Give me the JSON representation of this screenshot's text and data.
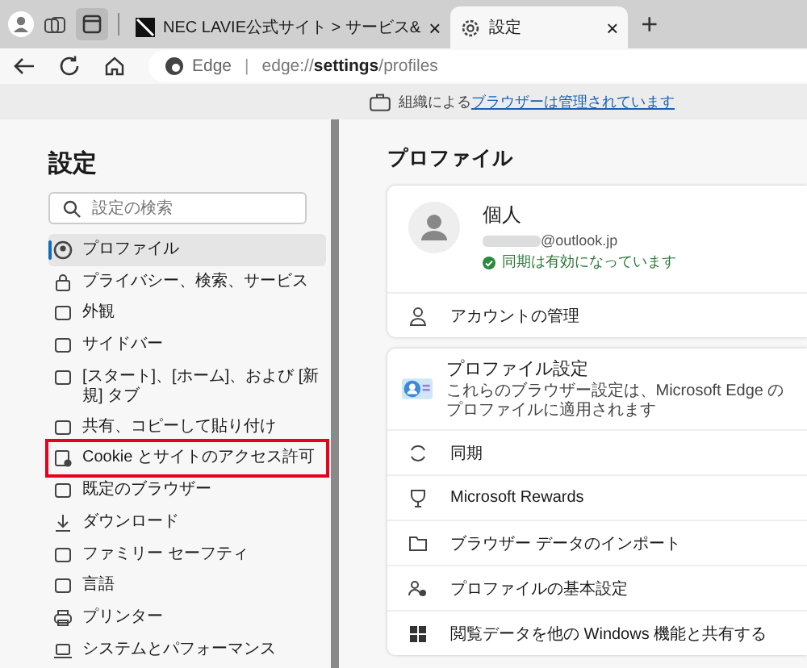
{
  "tabs": [
    {
      "label": "NEC LAVIE公式サイト > サービス&",
      "close": "×",
      "selected": false
    },
    {
      "label": "設定",
      "close": "×",
      "selected": true
    }
  ],
  "new_tab": "+",
  "address": {
    "site": "Edge",
    "separator": "|",
    "url": "edge://**settings**/profiles"
  },
  "managed_bar": {
    "prefix": "組織による",
    "link": "ブラウザーは管理されています"
  },
  "sidebar": {
    "title": "設定",
    "search": {
      "placeholder": "設定の検索"
    },
    "items": [
      {
        "label": "プロファイル",
        "selected": true,
        "highlighted": false
      },
      {
        "label": "プライバシー、検索、サービス",
        "selected": false,
        "highlighted": false
      },
      {
        "label": "外観",
        "selected": false,
        "highlighted": false
      },
      {
        "label": "サイドバー",
        "selected": false,
        "highlighted": false
      },
      {
        "label": "[スタート]、[ホーム]、および [新規] タブ",
        "selected": false,
        "highlighted": false
      },
      {
        "label": "共有、コピーして貼り付け",
        "selected": false,
        "highlighted": false
      },
      {
        "label": "Cookie とサイトのアクセス許可",
        "selected": false,
        "highlighted": true
      },
      {
        "label": "既定のブラウザー",
        "selected": false,
        "highlighted": false
      },
      {
        "label": "ダウンロード",
        "selected": false,
        "highlighted": false
      },
      {
        "label": "ファミリー セーフティ",
        "selected": false,
        "highlighted": false
      },
      {
        "label": "言語",
        "selected": false,
        "highlighted": false
      },
      {
        "label": "プリンター",
        "selected": false,
        "highlighted": false
      },
      {
        "label": "システムとパフォーマンス",
        "selected": false,
        "highlighted": false
      }
    ]
  },
  "main": {
    "title": "プロファイル",
    "profile": {
      "name": "個人",
      "email": "@outlook.jp",
      "sync_status": "同期は有効になっています",
      "manage": "アカウントの管理"
    },
    "settings_card": {
      "title": "プロファイル設定",
      "description": "これらのブラウザー設定は、Microsoft Edge のプロファイルに適用されます"
    },
    "rows": [
      "同期",
      "Microsoft Rewards",
      "ブラウザー データのインポート",
      "プロファイルの基本設定",
      "閲覧データを他の Windows 機能と共有する"
    ]
  }
}
